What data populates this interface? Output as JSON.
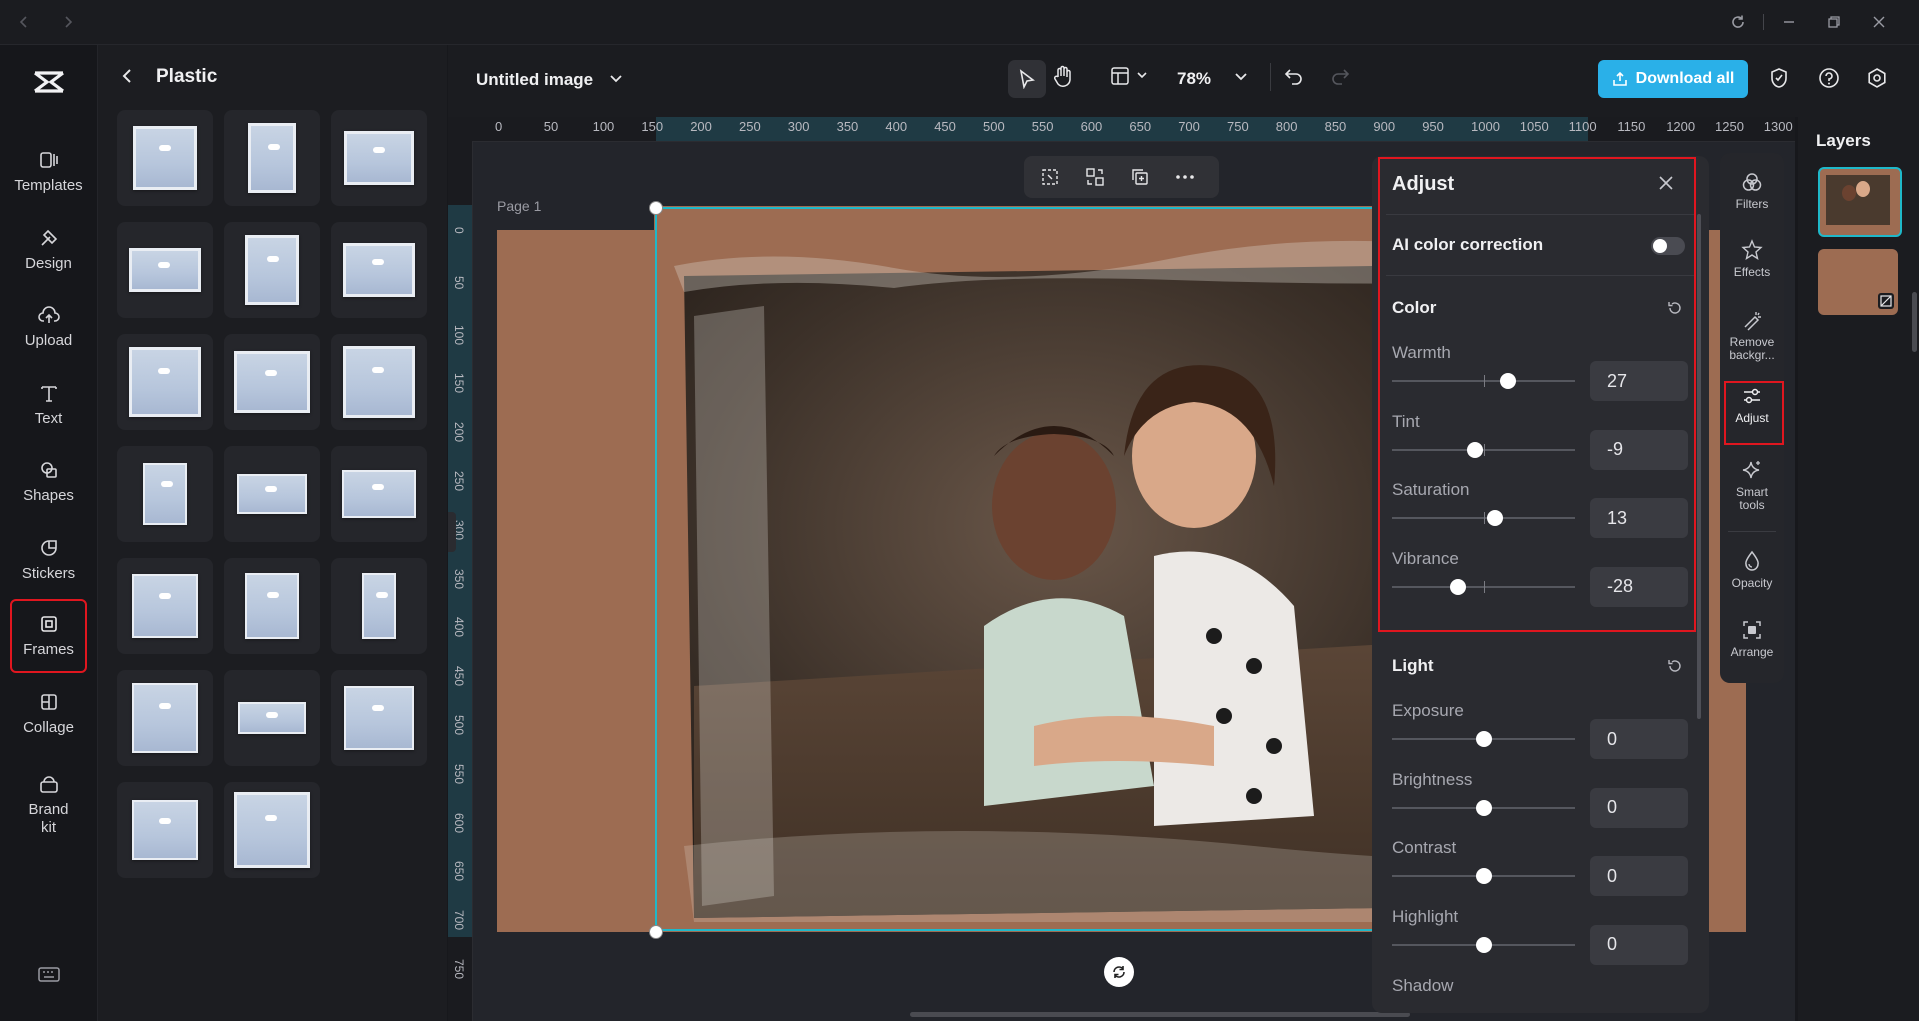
{
  "window": {
    "title": ""
  },
  "nav": {
    "items": [
      {
        "label": "Templates",
        "icon": "templates-icon"
      },
      {
        "label": "Design",
        "icon": "design-icon"
      },
      {
        "label": "Upload",
        "icon": "upload-icon"
      },
      {
        "label": "Text",
        "icon": "text-icon"
      },
      {
        "label": "Shapes",
        "icon": "shapes-icon"
      },
      {
        "label": "Stickers",
        "icon": "stickers-icon"
      },
      {
        "label": "Frames",
        "icon": "frames-icon",
        "active": true
      },
      {
        "label": "Collage",
        "icon": "collage-icon"
      },
      {
        "label": "Brand kit",
        "icon": "brand-kit-icon"
      }
    ]
  },
  "panel": {
    "title": "Plastic",
    "thumb_count": 17
  },
  "topbar": {
    "doc_title": "Untitled image",
    "zoom": "78%",
    "download_label": "Download all"
  },
  "ruler": {
    "top_ticks": [
      "0",
      "50",
      "100",
      "150",
      "200",
      "250",
      "300",
      "350",
      "400",
      "450",
      "500",
      "550",
      "600",
      "650",
      "700",
      "750",
      "800",
      "850",
      "900",
      "950",
      "1000",
      "1050",
      "1100",
      "1150",
      "1200",
      "1250",
      "1300"
    ],
    "left_ticks": [
      "0",
      "50",
      "100",
      "150",
      "200",
      "250",
      "300",
      "350",
      "400",
      "450",
      "500",
      "550",
      "600",
      "650",
      "700",
      "750"
    ]
  },
  "canvas": {
    "page_label": "Page 1"
  },
  "adjust": {
    "title": "Adjust",
    "ai_label": "AI color correction",
    "ai_enabled": false,
    "color_section": "Color",
    "light_section": "Light",
    "color_sliders": [
      {
        "label": "Warmth",
        "value": "27",
        "level": 0.635
      },
      {
        "label": "Tint",
        "value": "-9",
        "level": 0.455
      },
      {
        "label": "Saturation",
        "value": "13",
        "level": 0.565
      },
      {
        "label": "Vibrance",
        "value": "-28",
        "level": 0.36
      }
    ],
    "light_sliders": [
      {
        "label": "Exposure",
        "value": "0",
        "level": 0.5
      },
      {
        "label": "Brightness",
        "value": "0",
        "level": 0.5
      },
      {
        "label": "Contrast",
        "value": "0",
        "level": 0.5
      },
      {
        "label": "Highlight",
        "value": "0",
        "level": 0.5
      }
    ],
    "shadow_label": "Shadow"
  },
  "tools": {
    "items": [
      {
        "label": "Filters"
      },
      {
        "label": "Effects"
      },
      {
        "label": "Remove backgr..."
      },
      {
        "label": "Adjust",
        "active": true
      },
      {
        "label": "Smart tools"
      },
      {
        "label": "Opacity"
      },
      {
        "label": "Arrange"
      }
    ]
  },
  "layers": {
    "title": "Layers"
  },
  "colors": {
    "accent": "#2ab0e8",
    "highlight": "#e0161f",
    "page": "#9d6c52",
    "selection": "#1fb8c9"
  }
}
